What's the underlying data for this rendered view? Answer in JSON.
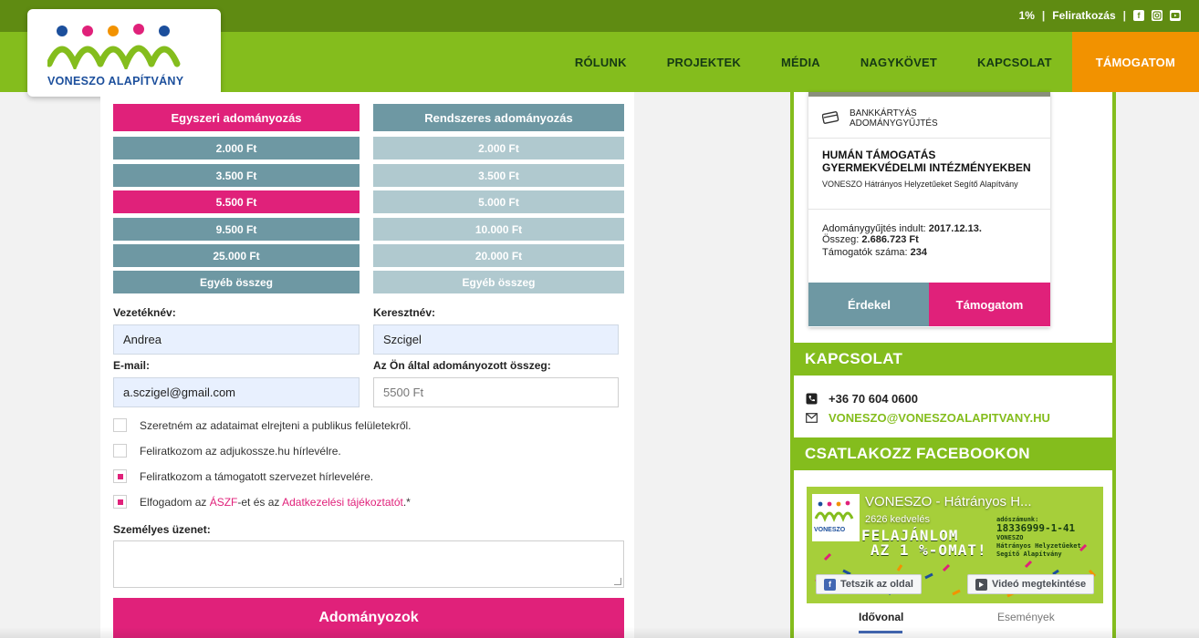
{
  "header": {
    "logo_text": "VONESZO ALAPÍTVÁNY",
    "top_links": {
      "one_percent": "1%",
      "subscribe": "Feliratkozás",
      "sep": "|"
    },
    "social": {
      "facebook": "facebook-icon",
      "instagram": "instagram-icon",
      "youtube": "youtube-icon"
    },
    "nav": [
      "RÓLUNK",
      "PROJEKTEK",
      "MÉDIA",
      "NAGYKÖVET",
      "KAPCSOLAT"
    ],
    "nav_active": "TÁMOGATOM"
  },
  "colors": {
    "dark_green": "#5f8b12",
    "green": "#84bd1d",
    "orange": "#f29200",
    "pink": "#e0217a",
    "teal": "#6e98a3",
    "light_teal": "#b0c9cf"
  },
  "donation": {
    "tab_once": "Egyszeri adományozás",
    "tab_recurring": "Rendszeres adományozás",
    "once_amounts": [
      "2.000 Ft",
      "3.500 Ft",
      "5.500 Ft",
      "9.500 Ft",
      "25.000 Ft",
      "Egyéb összeg"
    ],
    "recurring_amounts": [
      "2.000 Ft",
      "3.500 Ft",
      "5.000 Ft",
      "10.000 Ft",
      "20.000 Ft",
      "Egyéb összeg"
    ],
    "selected_once": "5.500 Ft"
  },
  "form": {
    "last_name_label": "Vezetéknév:",
    "last_name_value": "Andrea",
    "first_name_label": "Keresztnév:",
    "first_name_value": "Szcigel",
    "email_label": "E-mail:",
    "email_value": "a.sczigel@gmail.com",
    "amount_label": "Az Ön által adományozott összeg:",
    "amount_value": "5500 Ft",
    "checkboxes": [
      {
        "label": "Szeretném az adataimat elrejteni a publikus felületekről.",
        "checked": false
      },
      {
        "label": "Feliratkozom az adjukossze.hu hírlevélre.",
        "checked": false
      },
      {
        "label": "Feliratkozom a támogatott szervezet hírlevelére.",
        "checked": true
      }
    ],
    "terms": {
      "pre": "Elfogadom az ",
      "aszf": "ÁSZF",
      "mid": "-et és az ",
      "privacy": "Adatkezelési tájékoztatót",
      "post": ".*",
      "checked": true
    },
    "message_label": "Személyes üzenet:",
    "submit_label": "Adományozok"
  },
  "card": {
    "type_line1": "BANKKÁRTYÁS",
    "type_line2": "ADOMÁNYGYŰJTÉS",
    "title": "HUMÁN TÁMOGATÁS GYERMEKVÉDELMI INTÉZMÉNYEKBEN",
    "org": "VONESZO Hátrányos Helyzetűeket Segítő Alapítvány",
    "started_label": "Adománygyűjtés indult: ",
    "started_value": "2017.12.13.",
    "sum_label": "Összeg: ",
    "sum_value": "2.686.723 Ft",
    "supporters_label": "Támogatók száma: ",
    "supporters_value": "234",
    "btn_details": "Érdekel",
    "btn_support": "Támogatom"
  },
  "contact": {
    "heading": "KAPCSOLAT",
    "phone": "+36 70 604 0600",
    "email": "VONESZO@VONESZOALAPITVANY.HU"
  },
  "facebook": {
    "heading": "CSATLAKOZZ FACEBOOKON",
    "page_title": "VONESZO - Hátrányos H...",
    "likes": "2626 kedvelés",
    "promo_line1": "FELAJÁNLOM",
    "promo_line2": "AZ 1 %-OMAT!",
    "tax_label": "adószámunk:",
    "tax_number": "18336999-1-41",
    "tax_org": "VONESZO",
    "tax_org2": "Hátrányos Helyzetűeket",
    "tax_org3": "Segítő Alapítvány",
    "logo_caption": "VONESZO",
    "like_btn": "Tetszik az oldal",
    "video_btn": "Videó megtekintése",
    "tab_timeline": "Idővonal",
    "tab_events": "Események"
  }
}
